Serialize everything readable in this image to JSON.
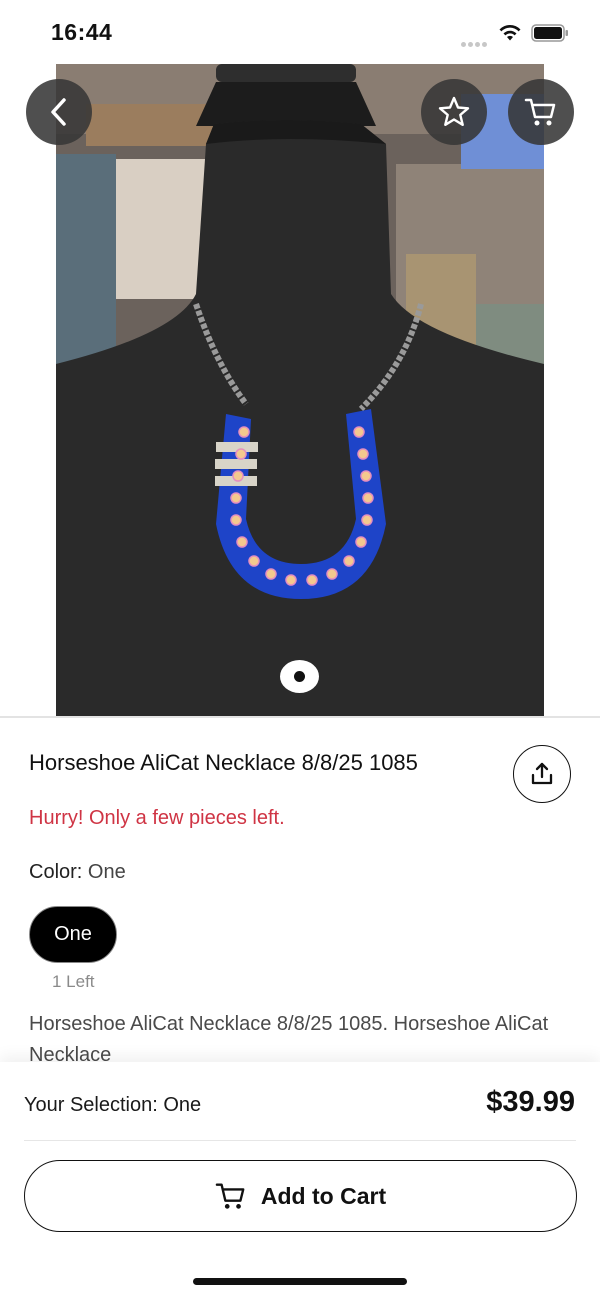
{
  "status_bar": {
    "time": "16:44",
    "icons": [
      "signal-dots-icon",
      "wifi-icon",
      "battery-icon"
    ]
  },
  "header": {
    "back_icon": "chevron-left-icon",
    "favorite_icon": "star-outline-icon",
    "cart_icon": "cart-icon"
  },
  "gallery": {
    "image_description_icon": "product-photo",
    "page_indicator": {
      "current": 1,
      "total": 1
    }
  },
  "product": {
    "title": "Horseshoe AliCat Necklace 8/8/25 1085",
    "stock_message": "Hurry! Only a few pieces left.",
    "color_label": "Color:",
    "color_value": "One",
    "variants": [
      {
        "label": "One",
        "stock": "1 Left",
        "selected": true
      }
    ],
    "description": "Horseshoe AliCat Necklace 8/8/25 1085. Horseshoe AliCat Necklace",
    "share_icon": "share-icon"
  },
  "bottom_bar": {
    "selection_label": "Your Selection:",
    "selection_value": "One",
    "price": "$39.99",
    "add_to_cart_label": "Add to Cart"
  },
  "colors": {
    "stock_warning": "#cf3444",
    "overlay_button": "#373737",
    "selected_pill": "#000000",
    "necklace_blue": "#1e44c8"
  }
}
